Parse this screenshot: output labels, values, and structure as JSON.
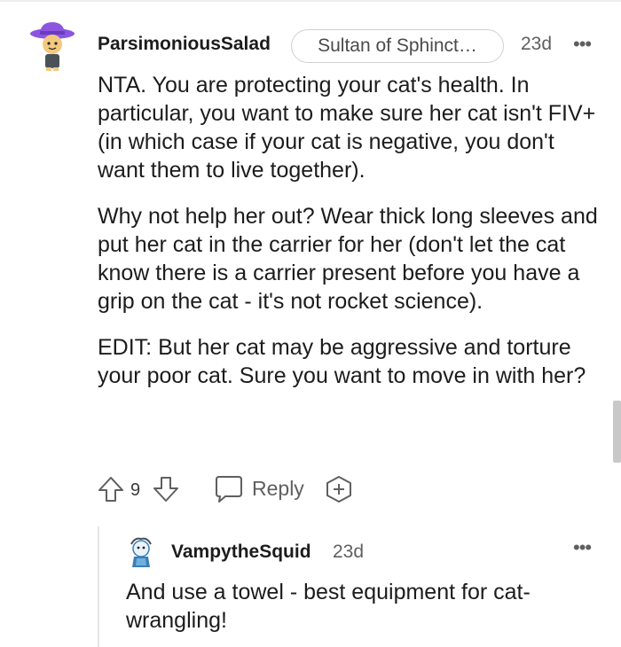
{
  "comment": {
    "username": "ParsimoniousSalad",
    "flair": "Sultan of Sphinct…",
    "age": "23d",
    "paragraphs": [
      "NTA. You are protecting your cat's health. In particular, you want to make sure her cat isn't FIV+ (in which case if your cat is negative, you don't want them to live together).",
      "Why not help her out? Wear thick long sleeves and put her cat in the carrier for her (don't let the cat know there is a carrier present before you have a grip on the cat - it's not rocket science).",
      "EDIT: But her cat may be aggressive and torture your poor cat. Sure you want to move in with her?"
    ],
    "score": "9",
    "reply_label": "Reply",
    "more_label": "•••",
    "icons": {
      "avatar": "snoo-avatar-purple-hat",
      "upvote": "upvote-arrow-icon",
      "downvote": "downvote-arrow-icon",
      "reply": "speech-bubble-icon",
      "award": "award-plus-icon",
      "more": "more-options-icon"
    }
  },
  "reply": {
    "username": "VampytheSquid",
    "age": "23d",
    "text": "And use a towel - best equipment for cat-wrangling!",
    "more_label": "•••",
    "icons": {
      "avatar": "snoo-avatar-squid"
    }
  },
  "colors": {
    "text": "#1c1c1c",
    "meta": "#5f5f5f",
    "hat": "#8b55e0",
    "thread_line": "#e6e6e6",
    "flair_border": "#d0d0d0"
  }
}
